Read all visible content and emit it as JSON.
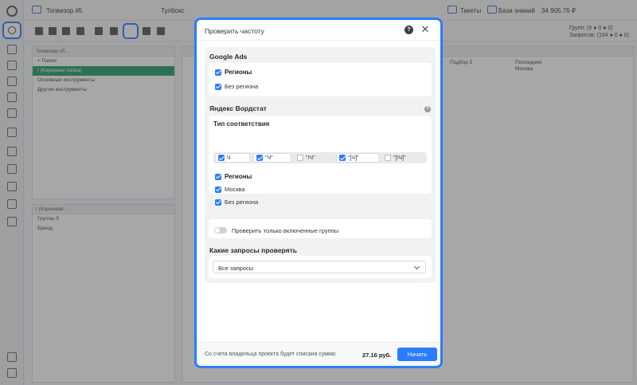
{
  "app": {
    "project_name": "Топвизор #5",
    "toolbox_label": "Тулбокс",
    "tickets_label": "Тикеты",
    "knowledge_base_label": "База знаний",
    "balance": "34 905.76 ₽",
    "stats_groups_label": "Групп:",
    "stats_groups_value": "(5 ● 0 ● 0)",
    "stats_queries_label": "Запросов:",
    "stats_queries_value": "(194 ● 0 ● 0)",
    "left_panel_title": "Топвизор #5...",
    "left_panel_cols": "+ Папки",
    "tree": [
      "/ (Корневая папка)",
      "Основные инструменты",
      "Другие инструменты"
    ],
    "groups_panel_title": "/ (Корневая ...",
    "groups_cols": "Группы 5",
    "groups_list": [
      "Бренд"
    ],
    "col_podbor": "Подбор 5",
    "col_posledn": "Последняя",
    "col_moscow": "Москва"
  },
  "modal": {
    "title": "Проверить частоту",
    "google": {
      "title": "Google Ads",
      "regions_label": "Регионы",
      "no_region_label": "Без региона"
    },
    "yandex": {
      "title": "Яндекс Вордстат",
      "match_title": "Тип соответствия",
      "match_types": [
        "Ч",
        "\"Ч\"",
        "\"!Ч\"",
        "\"[Ч]\"",
        "\"[!Ч]\""
      ],
      "regions_label": "Регионы",
      "region_moscow": "Москва",
      "no_region_label": "Без региона"
    },
    "only_enabled_label": "Проверить только включенные группы",
    "queries_title": "Какие запросы проверять",
    "queries_select_value": "Все запросы",
    "footer_text": "Со счета владельца проекта будет списана сумма:",
    "footer_sum": "27.16 руб.",
    "start_label": "Начать"
  }
}
